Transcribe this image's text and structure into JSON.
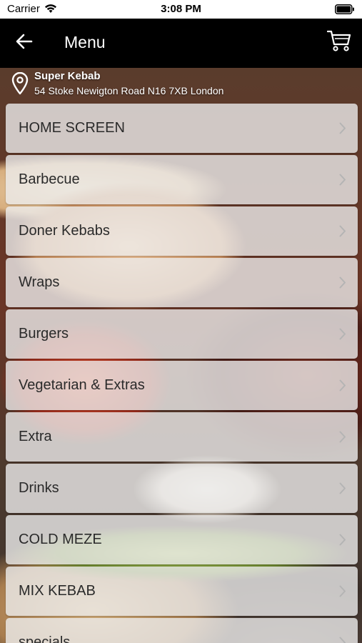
{
  "status_bar": {
    "carrier": "Carrier",
    "time": "3:08 PM",
    "icons": [
      "wifi-icon",
      "battery-icon"
    ]
  },
  "nav": {
    "title": "Menu",
    "back_icon": "arrow-left-icon",
    "cart_icon": "shopping-cart-icon"
  },
  "location": {
    "icon": "map-pin-icon",
    "name": "Super Kebab",
    "address": "54 Stoke Newigton Road N16 7XB London"
  },
  "menu": {
    "items": [
      {
        "label": "HOME SCREEN"
      },
      {
        "label": "Barbecue"
      },
      {
        "label": "Doner Kebabs"
      },
      {
        "label": "Wraps"
      },
      {
        "label": "Burgers"
      },
      {
        "label": "Vegetarian & Extras"
      },
      {
        "label": "Extra"
      },
      {
        "label": "Drinks"
      },
      {
        "label": "COLD MEZE"
      },
      {
        "label": "MIX KEBAB"
      },
      {
        "label": "specials"
      }
    ]
  },
  "colors": {
    "nav_background": "#000000",
    "row_background": "#ececec",
    "text": "#2a2a2a"
  }
}
